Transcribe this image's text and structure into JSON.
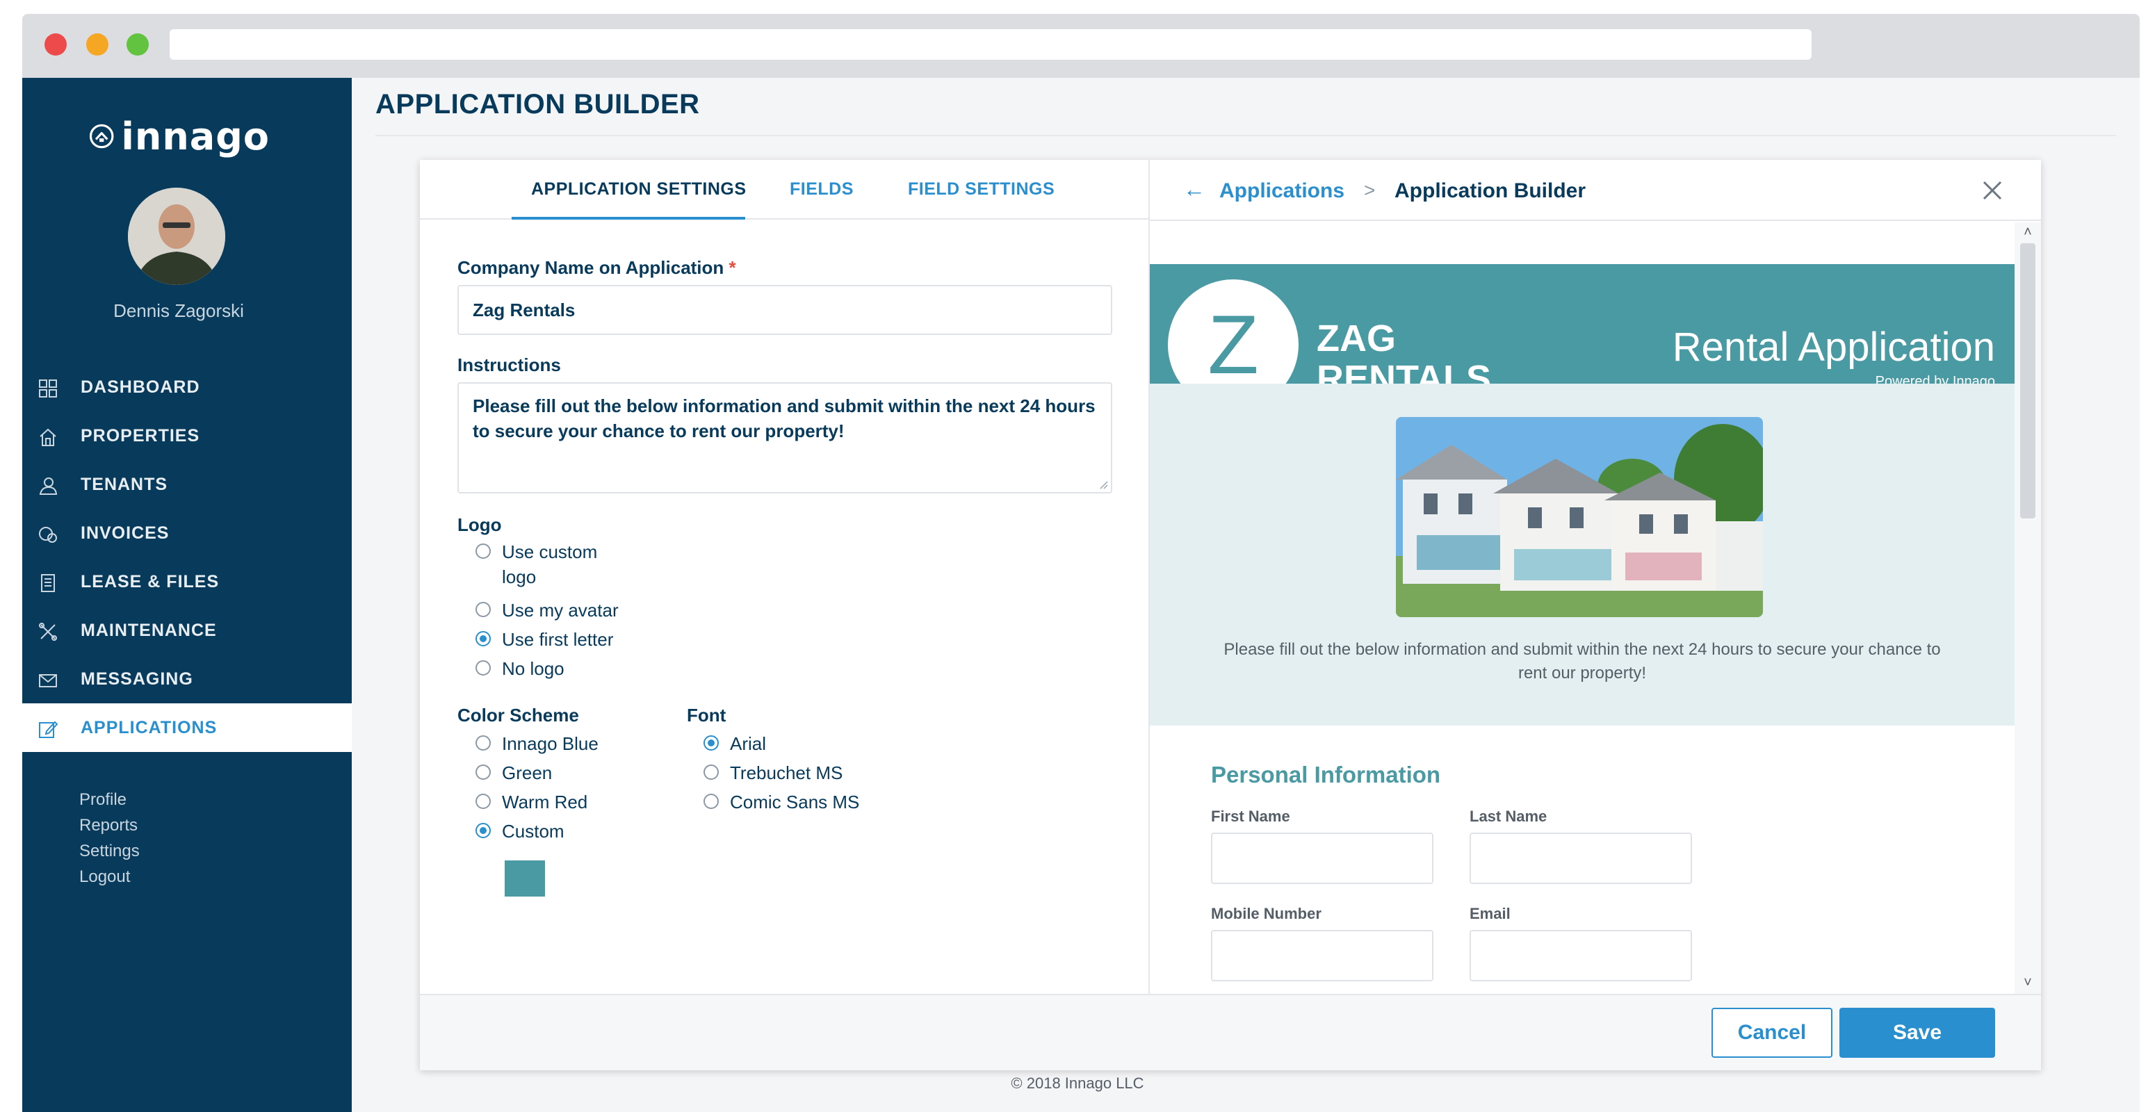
{
  "sidebar": {
    "logo_text": "innago",
    "user_name": "Dennis Zagorski",
    "items": [
      {
        "label": "DASHBOARD",
        "icon": "grid-icon"
      },
      {
        "label": "PROPERTIES",
        "icon": "house-icon"
      },
      {
        "label": "TENANTS",
        "icon": "tenants-icon"
      },
      {
        "label": "INVOICES",
        "icon": "invoice-icon"
      },
      {
        "label": "LEASE & FILES",
        "icon": "files-icon"
      },
      {
        "label": "MAINTENANCE",
        "icon": "tools-icon"
      },
      {
        "label": "MESSAGING",
        "icon": "envelope-icon"
      },
      {
        "label": "APPLICATIONS",
        "icon": "edit-icon",
        "active": true
      }
    ],
    "subnav": [
      "Profile",
      "Reports",
      "Settings",
      "Logout"
    ]
  },
  "page": {
    "title": "APPLICATION BUILDER",
    "copyright": "© 2018 Innago LLC"
  },
  "tabs": [
    "APPLICATION SETTINGS",
    "FIELDS",
    "FIELD SETTINGS"
  ],
  "form": {
    "company_label": "Company Name on Application",
    "required_mark": "*",
    "company_value": "Zag Rentals",
    "instructions_label": "Instructions",
    "instructions_value": "Please fill out the below information and submit within the next 24 hours to secure your chance to rent our property!",
    "logo_label": "Logo",
    "logo_options": [
      "Use custom logo",
      "Use my avatar",
      "Use first letter",
      "No logo"
    ],
    "logo_selected": "Use first letter",
    "color_label": "Color Scheme",
    "color_options": [
      "Innago Blue",
      "Green",
      "Warm Red",
      "Custom"
    ],
    "color_selected": "Custom",
    "custom_color": "#4a9aa3",
    "font_label": "Font",
    "font_options": [
      "Arial",
      "Trebuchet MS",
      "Comic Sans MS"
    ],
    "font_selected": "Arial"
  },
  "breadcrumb": {
    "back_arrow": "←",
    "link": "Applications",
    "separator": ">",
    "current": "Application Builder"
  },
  "preview": {
    "letter": "Z",
    "company": "ZAG RENTALS",
    "title": "Rental Application",
    "powered_by": "Powered by Innago",
    "instructions": "Please fill out the below information and submit within the next 24 hours to secure your chance to rent our property!",
    "section_title": "Personal Information",
    "fields": {
      "first_name": "First Name",
      "last_name": "Last Name",
      "mobile": "Mobile Number",
      "email": "Email"
    }
  },
  "buttons": {
    "cancel": "Cancel",
    "save": "Save"
  },
  "colors": {
    "sidebar": "#073a5b",
    "accent": "#2a8fce",
    "theme": "#4a9aa3"
  }
}
